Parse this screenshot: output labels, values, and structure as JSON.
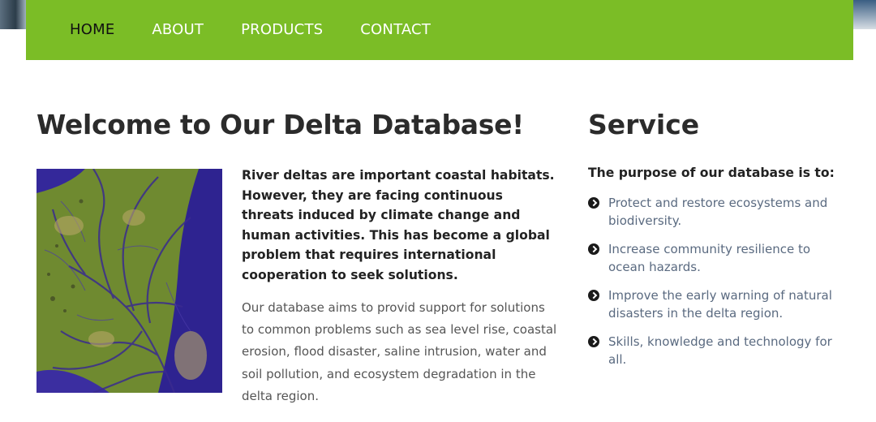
{
  "nav": {
    "items": [
      {
        "label": "HOME",
        "active": true
      },
      {
        "label": "ABOUT",
        "active": false
      },
      {
        "label": "PRODUCTS",
        "active": false
      },
      {
        "label": "CONTACT",
        "active": false
      }
    ],
    "bg_color": "#7bbd26"
  },
  "welcome": {
    "title": "Welcome to Our Delta Database!",
    "image_icon": "river-delta-satellite-image",
    "intro_bold": "River deltas are important coastal habitats. However, they are facing continuous threats induced by climate change and human activities. This has become a global problem that requires international cooperation to seek solutions.",
    "intro_body": "Our database aims to provid support for solutions to common problems such as sea level rise, coastal erosion, flood disaster, saline intrusion, water and soil pollution, and ecosystem degradation in the delta region."
  },
  "service": {
    "title": "Service",
    "subtitle": "The purpose of our database is to:",
    "bullet_icon": "chevron-right-circle-icon",
    "items": [
      "Protect and restore ecosystems and biodiversity.",
      "Increase community resilience to ocean hazards.",
      "Improve the early warning of natural disasters in the delta region.",
      "Skills, knowledge and technology for all."
    ]
  }
}
